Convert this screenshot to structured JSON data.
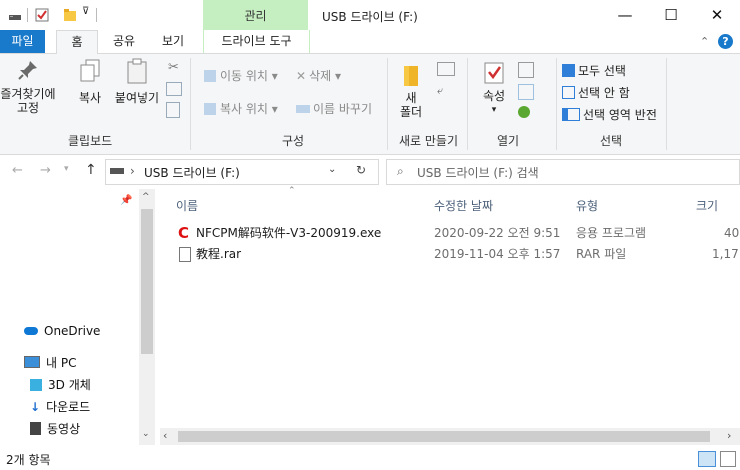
{
  "titlebar": {
    "context_tab": "관리",
    "window_title": "USB 드라이브 (F:)",
    "minimize": "—",
    "maximize": "☐",
    "close": "✕"
  },
  "tabs": {
    "file": "파일",
    "home": "홈",
    "share": "공유",
    "view": "보기",
    "drive_tools": "드라이브 도구"
  },
  "ribbon": {
    "clipboard": {
      "pin_quick_access": "즐겨찾기에\n고정",
      "copy": "복사",
      "paste": "붙여넣기",
      "label": "클립보드"
    },
    "organize": {
      "move_to": "이동 위치",
      "copy_to": "복사 위치",
      "delete": "삭제",
      "rename": "이름 바꾸기",
      "label": "구성"
    },
    "new": {
      "new_folder": "새\n폴더",
      "label": "새로 만들기"
    },
    "open": {
      "properties": "속성",
      "label": "열기"
    },
    "select": {
      "select_all": "모두 선택",
      "select_none": "선택 안 함",
      "invert_selection": "선택 영역 반전",
      "label": "선택"
    }
  },
  "address": {
    "path": "USB 드라이브 (F:)",
    "search_placeholder": "USB 드라이브 (F:) 검색"
  },
  "nav": {
    "items": [
      "OneDrive",
      "내 PC",
      "3D 개체",
      "다운로드",
      "동영상"
    ]
  },
  "filelist": {
    "columns": [
      "이름",
      "수정한 날짜",
      "유형",
      "크기"
    ],
    "rows": [
      {
        "name": "NFCPM解码软件-V3-200919.exe",
        "date": "2020-09-22 오전 9:51",
        "type": "응용 프로그램",
        "size": "40"
      },
      {
        "name": "教程.rar",
        "date": "2019-11-04 오후 1:57",
        "type": "RAR 파일",
        "size": "1,17"
      }
    ]
  },
  "status": {
    "item_count": "2개 항목"
  },
  "colors": {
    "accent": "#1979ca",
    "context_tab": "#c6efc1"
  }
}
